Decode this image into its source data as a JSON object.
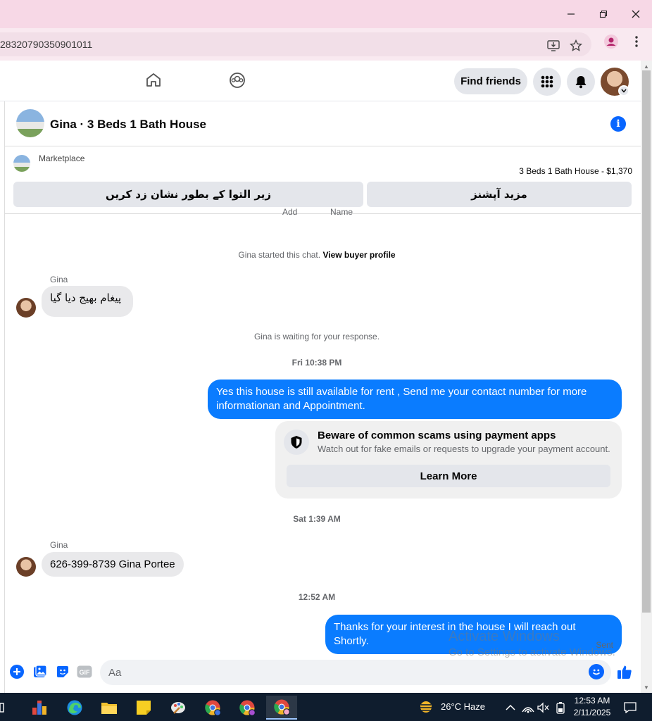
{
  "browser": {
    "url": "28320790350901011",
    "minimize_label": "─",
    "restore_label": "❐",
    "close_label": "✕"
  },
  "nav": {
    "find_friends": "Find friends"
  },
  "chat": {
    "title": "Gina · 3 Beds 1 Bath House",
    "marketplace_label": "Marketplace",
    "listing": "3 Beds 1 Bath House - $1,370",
    "mark_pending": "زیر التوا کے بطور نشان زد کریں",
    "more_options": "مزید آپشنز",
    "cut_left": "Add",
    "cut_right": "Name"
  },
  "messages": {
    "started_prefix": "Gina started this chat.",
    "view_profile": "View buyer profile",
    "sender1": "Gina",
    "msg1": "پیغام بھیج دیا گیا",
    "waiting": "Gina is waiting for your response.",
    "time1": "Fri 10:38 PM",
    "out1": "Yes this house is still available for rent , Send me your contact number for more informationan and Appointment.",
    "scam_title": "Beware of common scams using payment apps",
    "scam_sub": "Watch out for fake emails or requests to upgrade your payment account.",
    "learn_more": "Learn More",
    "time2": "Sat 1:39 AM",
    "sender2": "Gina",
    "msg2": "626-399-8739 Gina Portee",
    "time3": "12:52 AM",
    "out2": "Thanks for your interest in the house I will reach out Shortly.",
    "sent": "Sent"
  },
  "composer": {
    "placeholder": "Aa",
    "gif_label": "GIF"
  },
  "watermark": {
    "line1": "Activate Windows",
    "line2": "Go to Settings to activate Windows."
  },
  "taskbar": {
    "weather": "26°C  Haze",
    "time": "12:53 AM",
    "date": "2/11/2025"
  }
}
